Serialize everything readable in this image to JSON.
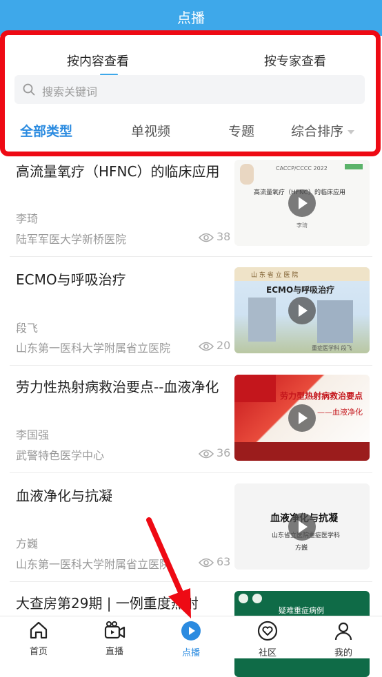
{
  "header": {
    "title": "点播"
  },
  "tabs": [
    {
      "label": "按内容查看",
      "active": true
    },
    {
      "label": "按专家查看",
      "active": false
    }
  ],
  "search": {
    "placeholder": "搜索关键词"
  },
  "categories": [
    {
      "label": "全部类型",
      "active": true
    },
    {
      "label": "单视频",
      "active": false
    },
    {
      "label": "专题",
      "active": false
    },
    {
      "label": "综合排序",
      "active": false
    }
  ],
  "videos": [
    {
      "title": "高流量氧疗（HFNC）的临床应用",
      "author": "李琦",
      "org": "陆军军医大学新桥医院",
      "views": "38",
      "thumb": {
        "header": "CACCP/CCCC 2022",
        "title": "高流量氧疗（HFNC）的临床应用",
        "author": "李琦"
      }
    },
    {
      "title": "ECMO与呼吸治疗",
      "author": "段飞",
      "org": "山东第一医科大学附属省立医院",
      "views": "20",
      "thumb": {
        "header": "山 东 省 立 医 院",
        "title": "ECMO与呼吸治疗",
        "footer": "重症医学科 段飞"
      }
    },
    {
      "title": "劳力性热射病救治要点--血液净化",
      "author": "李国强",
      "org": "武警特色医学中心",
      "views": "36",
      "thumb": {
        "title": "劳力型热射病救治要点",
        "subtitle": "——血液净化"
      }
    },
    {
      "title": "血液净化与抗凝",
      "author": "方巍",
      "org": "山东第一医科大学附属省立医院",
      "views": "63",
      "thumb": {
        "title": "血液净化与抗凝",
        "subtitle": "山东省立医院重症医学科",
        "author": "方巍"
      }
    },
    {
      "title": "大查房第29期 | 一例重度热射",
      "author": "",
      "org": "",
      "views": "",
      "thumb": {
        "title": "疑难重症病例"
      }
    }
  ],
  "bottom_nav": [
    {
      "label": "首页",
      "icon": "home-icon",
      "active": false
    },
    {
      "label": "直播",
      "icon": "live-camera-icon",
      "active": false
    },
    {
      "label": "点播",
      "icon": "play-circle-icon",
      "active": true
    },
    {
      "label": "社区",
      "icon": "community-heart-icon",
      "active": false
    },
    {
      "label": "我的",
      "icon": "profile-icon",
      "active": false
    }
  ],
  "colors": {
    "header": "#3ea8ea",
    "accent": "#2b8be0",
    "highlight_box": "#ee0a14",
    "arrow": "#ee0a14"
  }
}
